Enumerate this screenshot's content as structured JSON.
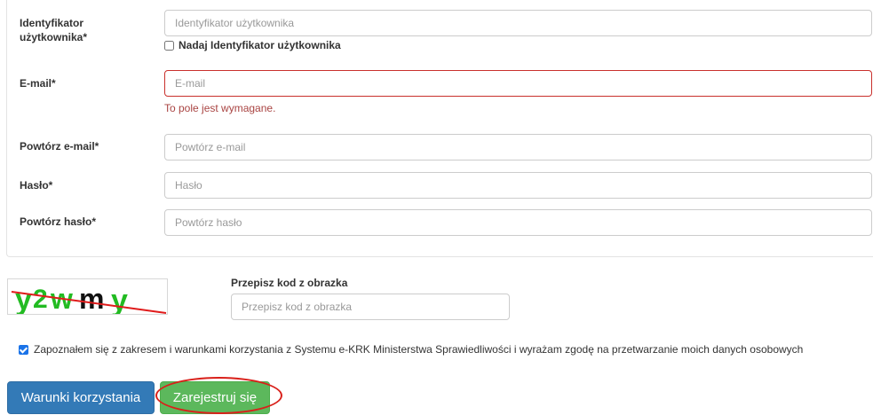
{
  "form": {
    "user_id": {
      "label_line1": "Identyfikator",
      "label_line2": "użytkownika*",
      "placeholder": "Identyfikator użytkownika",
      "assign_checkbox_label": "Nadaj Identyfikator użytkownika",
      "assign_checked": false
    },
    "email": {
      "label": "E-mail*",
      "placeholder": "E-mail",
      "error": "To pole jest wymagane.",
      "error_color": "#a94442"
    },
    "email_repeat": {
      "label": "Powtórz e-mail*",
      "placeholder": "Powtórz e-mail"
    },
    "password": {
      "label": "Hasło*",
      "placeholder": "Hasło"
    },
    "password_repeat": {
      "label": "Powtórz hasło*",
      "placeholder": "Powtórz hasło"
    }
  },
  "captcha": {
    "image_text": "y2wmy",
    "label": "Przepisz kod z obrazka",
    "placeholder": "Przepisz kod z obrazka"
  },
  "consent": {
    "checked": true,
    "text": "Zapoznałem się z zakresem i warunkami korzystania z Systemu e-KRK Ministerstwa Sprawiedliwości i wyrażam zgodę na przetwarzanie moich danych osobowych"
  },
  "buttons": {
    "terms_label": "Warunki korzystania",
    "register_label": "Zarejestruj się"
  },
  "colors": {
    "primary_blue": "#337ab7",
    "success_green": "#5cb85c",
    "error_red": "#c9302c",
    "highlight_red": "#d9201a"
  }
}
